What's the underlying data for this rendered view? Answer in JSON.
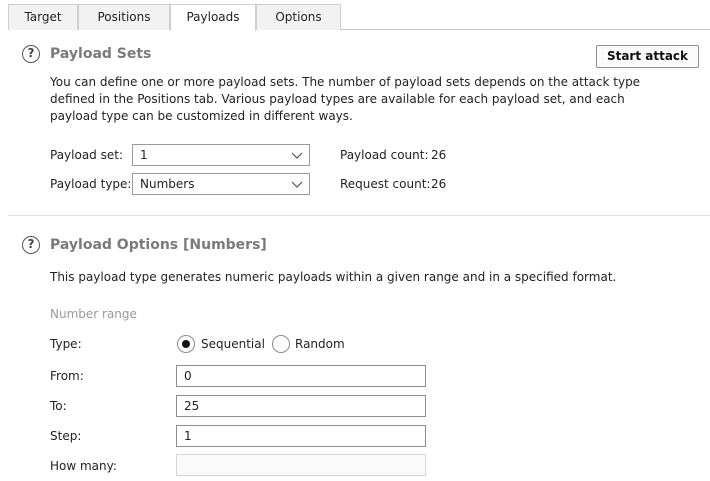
{
  "tabs": [
    {
      "label": "Target",
      "active": false
    },
    {
      "label": "Positions",
      "active": false
    },
    {
      "label": "Payloads",
      "active": true
    },
    {
      "label": "Options",
      "active": false
    }
  ],
  "payload_sets": {
    "title": "Payload Sets",
    "help_icon": "?",
    "description_lines": [
      "You can define one or more payload sets. The number of payload sets depends on the attack type",
      "defined in the Positions tab. Various payload types are available for each payload set, and each",
      "payload type can be customized in different ways."
    ],
    "start_attack_label": "Start attack",
    "payload_set_label": "Payload set:",
    "payload_set_value": "1",
    "payload_type_label": "Payload type:",
    "payload_type_value": "Numbers",
    "payload_count_label": "Payload count:",
    "payload_count_value": "26",
    "request_count_label": "Request count:",
    "request_count_value": "26"
  },
  "payload_options": {
    "title": "Payload Options [Numbers]",
    "help_icon": "?",
    "description": "This payload type generates numeric payloads within a given range and in a specified format.",
    "section_label": "Number range",
    "type_label": "Type:",
    "type_options": [
      "Sequential",
      "Random"
    ],
    "type_selected": "Sequential",
    "from_label": "From:",
    "from_value": "0",
    "to_label": "To:",
    "to_value": "25",
    "step_label": "Step:",
    "step_value": "1",
    "how_many_label": "How many:",
    "how_many_value": ""
  },
  "icons": [
    "help-icon",
    "chevron-down-icon",
    "radio-button-icon"
  ]
}
